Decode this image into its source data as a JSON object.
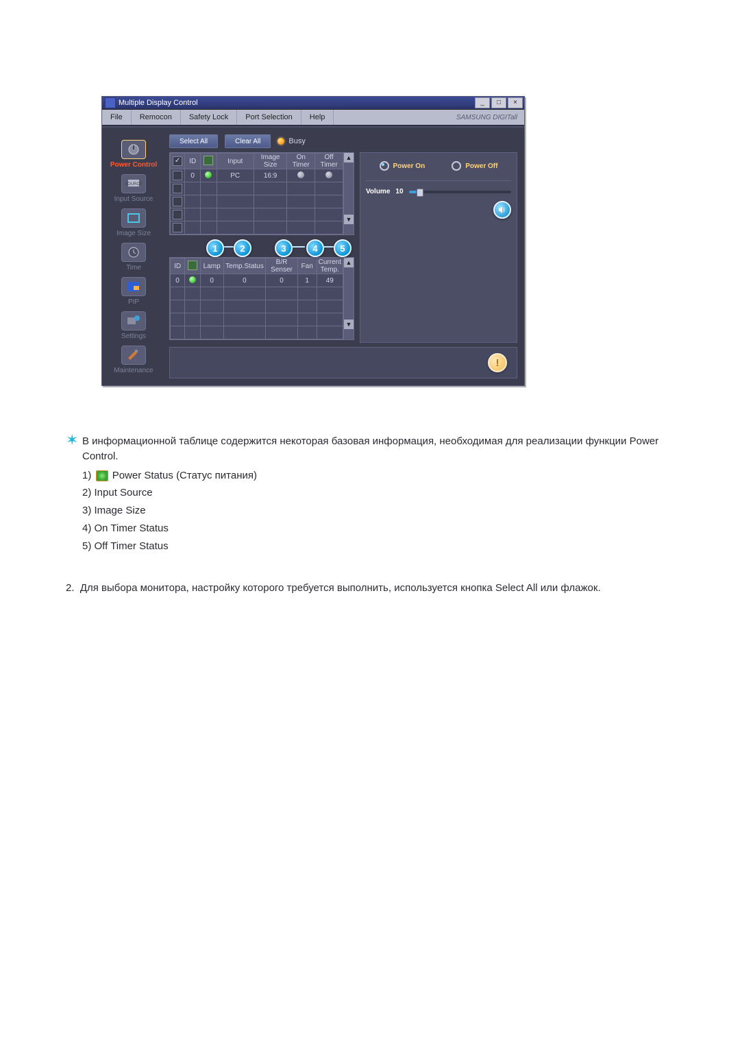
{
  "window": {
    "title": "Multiple Display Control",
    "branding": "SAMSUNG DIGITall"
  },
  "menu": [
    "File",
    "Remocon",
    "Safety Lock",
    "Port Selection",
    "Help"
  ],
  "sidebar": [
    {
      "id": "power",
      "label": "Power Control",
      "active": true
    },
    {
      "id": "input",
      "label": "Input Source",
      "active": false
    },
    {
      "id": "imagesize",
      "label": "Image Size",
      "active": false
    },
    {
      "id": "time",
      "label": "Time",
      "active": false
    },
    {
      "id": "pip",
      "label": "PIP",
      "active": false
    },
    {
      "id": "settings",
      "label": "Settings",
      "active": false
    },
    {
      "id": "maintenance",
      "label": "Maintenance",
      "active": false
    }
  ],
  "toolbar": {
    "select_all": "Select All",
    "clear_all": "Clear All",
    "busy": "Busy"
  },
  "grid1": {
    "headers": [
      "",
      "ID",
      "",
      "Input",
      "Image Size",
      "On Timer",
      "Off Timer"
    ],
    "rows": [
      {
        "checked": false,
        "id": "0",
        "status": "green",
        "input": "PC",
        "image_size": "16:9",
        "on_timer": "off",
        "off_timer": "off"
      },
      {
        "checked": false,
        "id": "",
        "status": "",
        "input": "",
        "image_size": "",
        "on_timer": "",
        "off_timer": ""
      },
      {
        "checked": false,
        "id": "",
        "status": "",
        "input": "",
        "image_size": "",
        "on_timer": "",
        "off_timer": ""
      },
      {
        "checked": false,
        "id": "",
        "status": "",
        "input": "",
        "image_size": "",
        "on_timer": "",
        "off_timer": ""
      },
      {
        "checked": false,
        "id": "",
        "status": "",
        "input": "",
        "image_size": "",
        "on_timer": "",
        "off_timer": ""
      }
    ]
  },
  "grid2": {
    "headers": [
      "ID",
      "",
      "Lamp",
      "Temp.Status",
      "B/R Senser",
      "Fan",
      "Current Temp."
    ],
    "rows": [
      {
        "id": "0",
        "status": "green",
        "lamp": "0",
        "temp_status": "0",
        "br_senser": "0",
        "fan": "1",
        "temp": "49"
      },
      {
        "id": "",
        "status": "",
        "lamp": "",
        "temp_status": "",
        "br_senser": "",
        "fan": "",
        "temp": ""
      },
      {
        "id": "",
        "status": "",
        "lamp": "",
        "temp_status": "",
        "br_senser": "",
        "fan": "",
        "temp": ""
      },
      {
        "id": "",
        "status": "",
        "lamp": "",
        "temp_status": "",
        "br_senser": "",
        "fan": "",
        "temp": ""
      },
      {
        "id": "",
        "status": "",
        "lamp": "",
        "temp_status": "",
        "br_senser": "",
        "fan": "",
        "temp": ""
      }
    ]
  },
  "callouts": [
    "1",
    "2",
    "3",
    "4",
    "5"
  ],
  "right": {
    "power_on": "Power On",
    "power_off": "Power Off",
    "volume_label": "Volume",
    "volume_value": "10",
    "volume_pct": 8
  },
  "notes": {
    "intro": "В информационной таблице содержится некоторая базовая информация, необходимая для реализации функции Power Control.",
    "items": [
      "Power Status (Статус питания)",
      "Input Source",
      "Image Size",
      "On Timer Status",
      "Off Timer Status"
    ],
    "item_prefix": [
      "1)",
      "2)",
      "3)",
      "4)",
      "5)"
    ],
    "para2_prefix": "2.",
    "para2": "Для выбора монитора, настройку которого требуется выполнить, используется кнопка Select All или флажок."
  }
}
